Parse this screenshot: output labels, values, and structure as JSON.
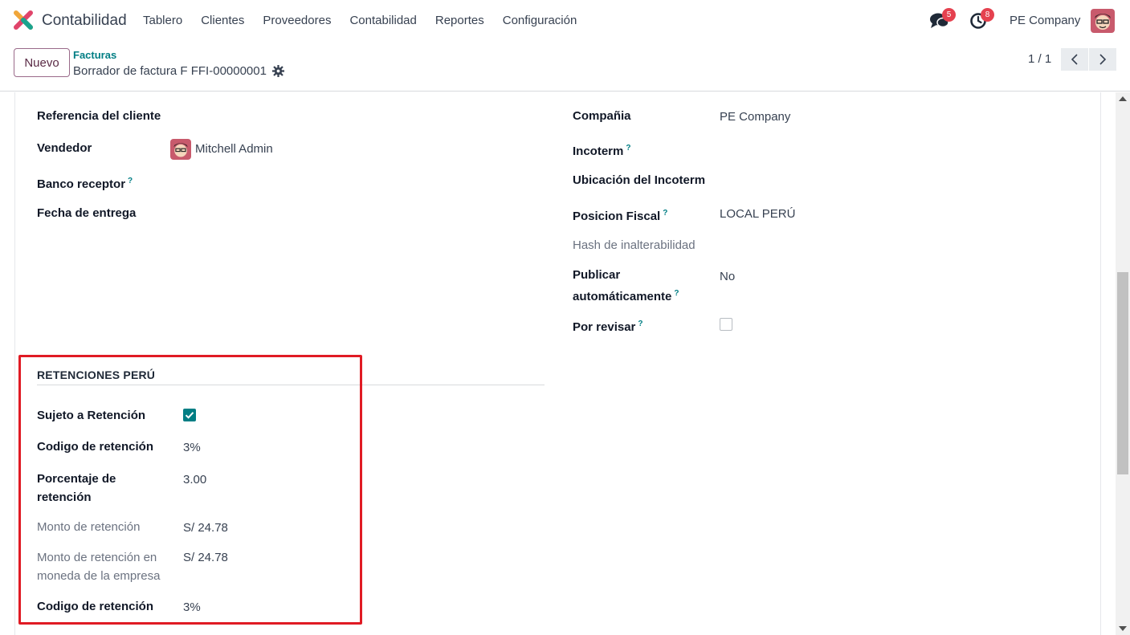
{
  "app": {
    "title": "Contabilidad",
    "logo_icon": "odoo-accounting-logo"
  },
  "menu": [
    "Tablero",
    "Clientes",
    "Proveedores",
    "Contabilidad",
    "Reportes",
    "Configuración"
  ],
  "nav": {
    "messages_badge": "5",
    "activities_badge": "8",
    "company": "PE Company"
  },
  "control": {
    "new_label": "Nuevo",
    "breadcrumb_parent": "Facturas",
    "breadcrumb_current": "Borrador de factura F FFI-00000001",
    "pager": "1 / 1"
  },
  "left_fields": {
    "ref_label": "Referencia del cliente",
    "seller_label": "Vendedor",
    "seller_value": "Mitchell Admin",
    "bank_label": "Banco receptor",
    "delivery_label": "Fecha de entrega"
  },
  "right_fields": {
    "company_label": "Compañia",
    "company_value": "PE Company",
    "incoterm_label": "Incoterm",
    "incoterm_loc_label": "Ubicación del Incoterm",
    "fiscal_label": "Posicion Fiscal",
    "fiscal_value": "LOCAL PERÚ",
    "hash_label": "Hash de inalterabilidad",
    "autopost_label_1": "Publicar",
    "autopost_label_2": "automáticamente",
    "autopost_value": "No",
    "review_label": "Por revisar",
    "review_checked": false
  },
  "retention": {
    "section_title": "RETENCIONES PERÚ",
    "subject_label": "Sujeto a Retención",
    "subject_checked": true,
    "code_label": "Codigo de retención",
    "code_value": "3%",
    "pct_label_1": "Porcentaje de",
    "pct_label_2": "retención",
    "pct_value": "3.00",
    "amount_label": "Monto de retención",
    "amount_value": "S/ 24.78",
    "amount_co_label_1": "Monto de retención en",
    "amount_co_label_2": "moneda de la empresa",
    "amount_co_value": "S/ 24.78",
    "code2_label": "Codigo de retención",
    "code2_value": "3%"
  },
  "colors": {
    "accent": "#017e84",
    "brand": "#714b67",
    "highlight": "#e01b24",
    "badge": "#e5414f"
  }
}
